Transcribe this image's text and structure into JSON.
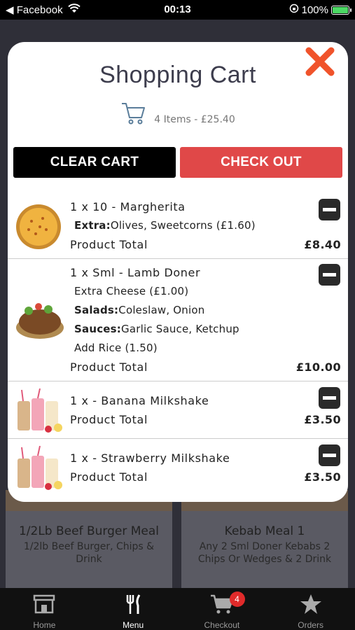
{
  "status_bar": {
    "back_app": "◀ Facebook",
    "time": "00:13",
    "battery": "100%"
  },
  "background_menu": {
    "cards": [
      {
        "title": "1/2Lb Beef Burger Meal",
        "desc": "1/2lb Beef Burger, Chips & Drink"
      },
      {
        "title": "Kebab Meal 1",
        "desc": "Any 2 Sml Doner Kebabs 2 Chips Or Wedges & 2 Drink"
      }
    ]
  },
  "cart": {
    "title": "Shopping Cart",
    "summary": "4 Items - £25.40",
    "clear_label": "CLEAR CART",
    "checkout_label": "CHECK OUT",
    "product_total_label": "Product Total",
    "items": [
      {
        "name": "1 x 10 - Margherita",
        "extra_label": "Extra:",
        "extra_value": "Olives, Sweetcorns (£1.60)",
        "total": "£8.40"
      },
      {
        "name": "1 x Sml - Lamb Doner",
        "option1": "Extra Cheese (£1.00)",
        "salads_label": "Salads:",
        "salads_value": "Coleslaw, Onion",
        "sauces_label": "Sauces:",
        "sauces_value": "Garlic Sauce, Ketchup",
        "option2": "Add Rice (1.50)",
        "total": "£10.00"
      },
      {
        "name": "1 x - Banana Milkshake",
        "total": "£3.50"
      },
      {
        "name": "1 x - Strawberry Milkshake",
        "total": "£3.50"
      }
    ]
  },
  "tabbar": {
    "tabs": [
      {
        "label": "Home",
        "icon": "store-icon"
      },
      {
        "label": "Menu",
        "icon": "cutlery-icon"
      },
      {
        "label": "Checkout",
        "icon": "cart-icon",
        "badge": "4"
      },
      {
        "label": "Orders",
        "icon": "star-icon"
      }
    ]
  },
  "colors": {
    "checkout": "#e04848",
    "close": "#f0532b",
    "badge": "#e02a2a"
  }
}
